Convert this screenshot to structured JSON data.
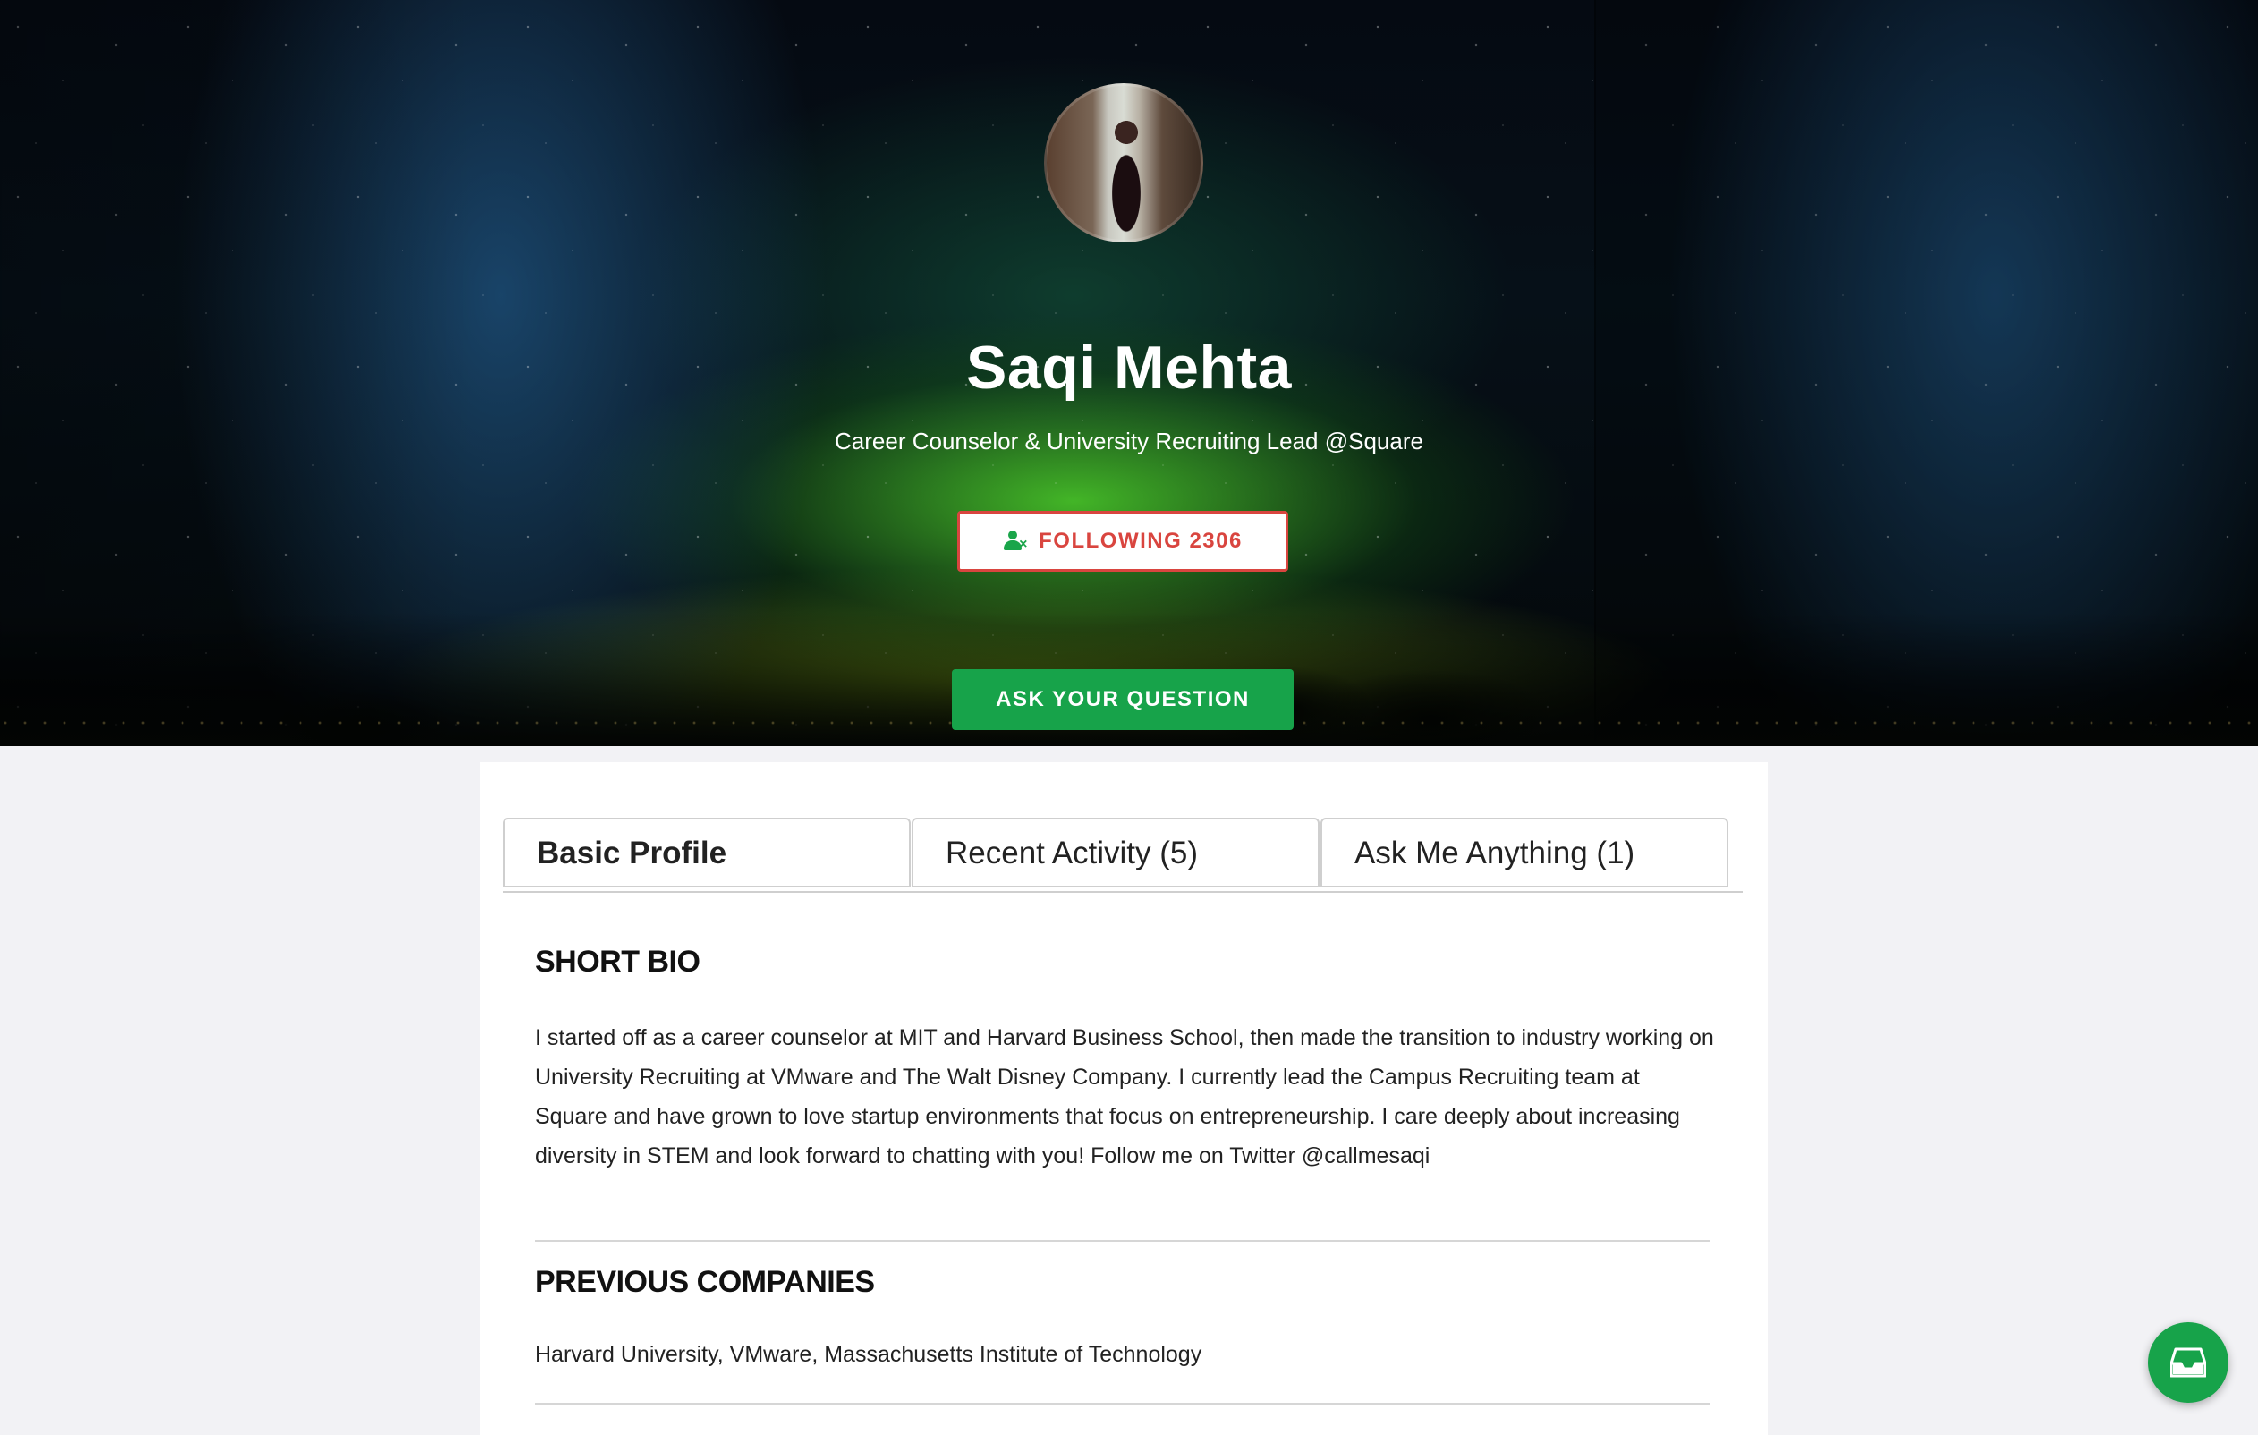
{
  "profile": {
    "name": "Saqi Mehta",
    "headline": "Career Counselor & University Recruiting Lead @Square",
    "follow_label": "FOLLOWING 2306",
    "ask_label": "ASK YOUR QUESTION"
  },
  "tabs": [
    {
      "label": "Basic Profile",
      "active": true
    },
    {
      "label": "Recent Activity (5)",
      "active": false
    },
    {
      "label": "Ask Me Anything (1)",
      "active": false
    }
  ],
  "sections": {
    "bio_title": "SHORT BIO",
    "bio_text": "I started off as a career counselor at MIT and Harvard Business School, then made the transition to industry working on University Recruiting at VMware and The Walt Disney Company. I currently lead the Campus Recruiting team at Square and have grown to love startup environments that focus on entrepreneurship. I care deeply about increasing diversity in STEM and look forward to chatting with you! Follow me on Twitter @callmesaqi",
    "companies_title": "PREVIOUS COMPANIES",
    "companies_text": "Harvard University, VMware, Massachusetts Institute of Technology"
  },
  "colors": {
    "accent_green": "#17a34a",
    "follow_red": "#d9453f"
  },
  "icons": {
    "follow": "user-unfollow-icon",
    "fab": "inbox-icon"
  }
}
